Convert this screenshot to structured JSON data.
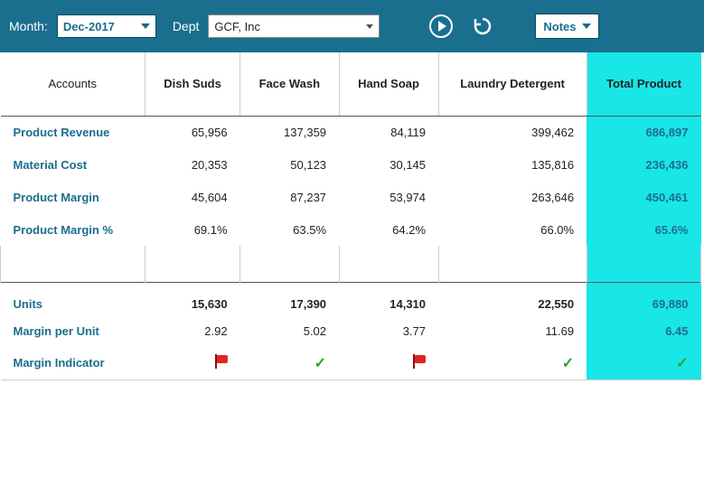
{
  "toolbar": {
    "month_label": "Month:",
    "month_value": "Dec-2017",
    "dept_label": "Dept",
    "dept_value": "GCF, Inc",
    "notes_label": "Notes"
  },
  "table": {
    "header": {
      "accounts": "Accounts",
      "col1": "Dish Suds",
      "col2": "Face Wash",
      "col3": "Hand Soap",
      "col4": "Laundry Detergent",
      "col_total": "Total Product"
    },
    "rows": [
      {
        "label": "Product Revenue",
        "c1": "65,956",
        "c2": "137,359",
        "c3": "84,119",
        "c4": "399,462",
        "total": "686,897"
      },
      {
        "label": "Material Cost",
        "c1": "20,353",
        "c2": "50,123",
        "c3": "30,145",
        "c4": "135,816",
        "total": "236,436"
      },
      {
        "label": "Product Margin",
        "c1": "45,604",
        "c2": "87,237",
        "c3": "53,974",
        "c4": "263,646",
        "total": "450,461"
      },
      {
        "label": "Product Margin %",
        "c1": "69.1%",
        "c2": "63.5%",
        "c3": "64.2%",
        "c4": "66.0%",
        "total": "65.6%"
      }
    ],
    "rows2": [
      {
        "label": "Units",
        "c1": "15,630",
        "c2": "17,390",
        "c3": "14,310",
        "c4": "22,550",
        "total": "69,880"
      },
      {
        "label": "Margin per Unit",
        "c1": "2.92",
        "c2": "5.02",
        "c3": "3.77",
        "c4": "11.69",
        "total": "6.45"
      }
    ],
    "indicator": {
      "label": "Margin Indicator",
      "c1": "flag",
      "c2": "check",
      "c3": "flag",
      "c4": "check",
      "total": "check"
    }
  }
}
